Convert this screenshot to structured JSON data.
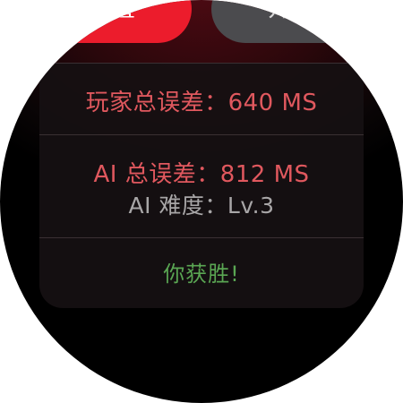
{
  "buttons": {
    "reset_label": "重置",
    "start_label": "开始"
  },
  "stats": {
    "player_error": "玩家总误差：640 MS",
    "ai_error": "AI 总误差：812 MS",
    "ai_level": "AI 难度：Lv.3"
  },
  "result": {
    "message": "你获胜!"
  },
  "colors": {
    "reset_button": "#ec1c2c",
    "start_button": "#4b4b4e",
    "error_text": "#e0585e",
    "level_text": "#a8a6a7",
    "win_text": "#5aa653"
  }
}
